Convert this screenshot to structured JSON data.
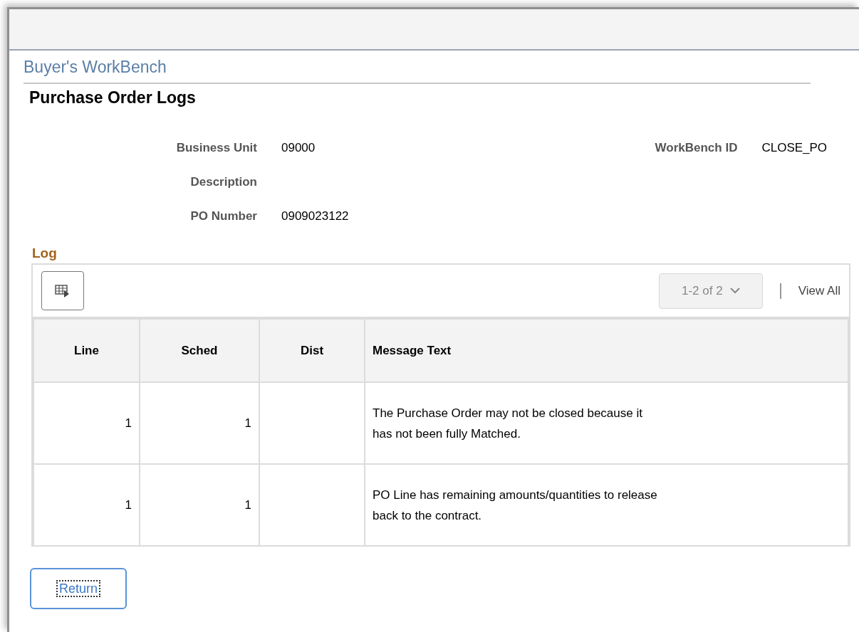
{
  "breadcrumb": "Buyer's WorkBench",
  "page_title": "Purchase Order Logs",
  "fields": [
    {
      "label": "Business Unit",
      "value": "09000"
    },
    {
      "label": "Description"
    },
    {
      "label": "PO Number",
      "value": "0909023122"
    }
  ],
  "side_field": {
    "label": "WorkBench ID",
    "value": "CLOSE_PO"
  },
  "log": {
    "title": "Log",
    "pager": "1-2 of 2",
    "view_all": "View All",
    "columns": [
      "Line",
      "Sched",
      "Dist",
      "Message Text"
    ],
    "rows": [
      {
        "line": "1",
        "sched": "1",
        "message": "The Purchase Order may not be closed because it has not been fully Matched."
      },
      {
        "line": "1",
        "sched": "1",
        "message": "PO Line has remaining amounts/quantities to release back to the contract."
      }
    ]
  },
  "buttons": [
    "Return"
  ]
}
